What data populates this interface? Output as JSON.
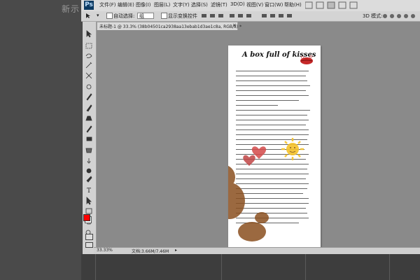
{
  "desktop": {
    "label": "新示"
  },
  "app": {
    "logo": "Ps"
  },
  "menu": [
    {
      "label": "文件(F)"
    },
    {
      "label": "编辑(E)"
    },
    {
      "label": "图像(I)"
    },
    {
      "label": "图层(L)"
    },
    {
      "label": "文字(Y)"
    },
    {
      "label": "选择(S)"
    },
    {
      "label": "滤镜(T)"
    },
    {
      "label": "3D(D)"
    },
    {
      "label": "视图(V)"
    },
    {
      "label": "窗口(W)"
    },
    {
      "label": "帮助(H)"
    }
  ],
  "options": {
    "auto_select_label": "自动选择:",
    "auto_select_value": "组",
    "show_transform_label": "显示变换控件",
    "mode_label": "3D 模式:"
  },
  "document": {
    "tab_title": "未标题-1 @ 33.3% (38b04501ca2938aa13ebab1d3ae1c8a, RGB/8) *",
    "page_title": "A box full of kisses"
  },
  "status": {
    "zoom": "33.33%",
    "doc_size": "文档:3.66M/7.46M"
  },
  "colors": {
    "foreground": "#ff0000",
    "background": "#ffffff",
    "heart_red": "#d44a4a",
    "bear_brown": "#8a4f1f",
    "sun_yellow": "#f6c32a"
  }
}
